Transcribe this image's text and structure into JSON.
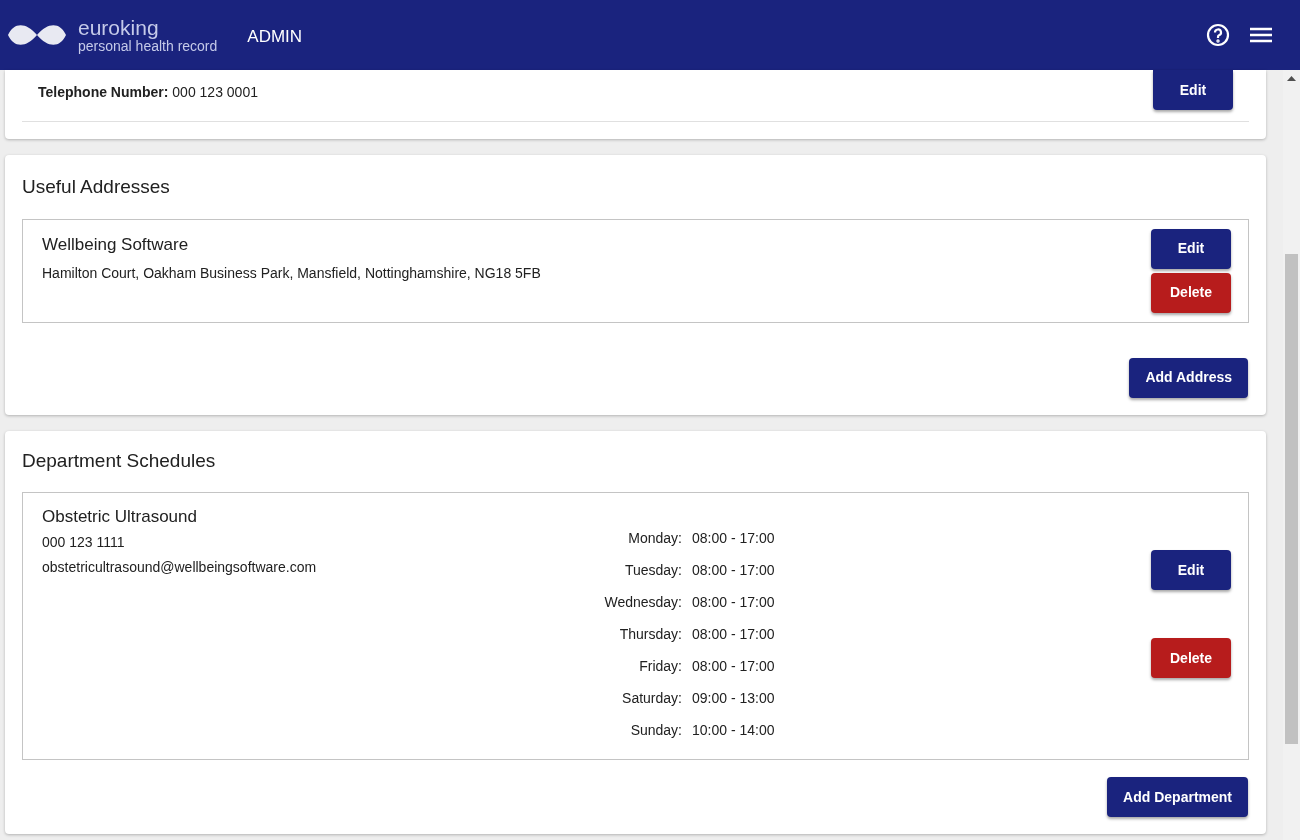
{
  "header": {
    "brand": "euroking",
    "tagline": "personal health record",
    "section": "ADMIN"
  },
  "contact_card": {
    "label": "Telephone Number:",
    "value": "000 123 0001",
    "edit_button": "Edit"
  },
  "useful_addresses": {
    "title": "Useful Addresses",
    "items": [
      {
        "name": "Wellbeing Software",
        "address": "Hamilton Court, Oakham Business Park, Mansfield, Nottinghamshire, NG18 5FB",
        "edit_button": "Edit",
        "delete_button": "Delete"
      }
    ],
    "add_button": "Add Address"
  },
  "department_schedules": {
    "title": "Department Schedules",
    "items": [
      {
        "name": "Obstetric Ultrasound",
        "phone": "000 123 1111",
        "email": "obstetricultrasound@wellbeingsoftware.com",
        "hours": [
          {
            "day": "Monday:",
            "time": "08:00 - 17:00"
          },
          {
            "day": "Tuesday:",
            "time": "08:00 - 17:00"
          },
          {
            "day": "Wednesday:",
            "time": "08:00 - 17:00"
          },
          {
            "day": "Thursday:",
            "time": "08:00 - 17:00"
          },
          {
            "day": "Friday:",
            "time": "08:00 - 17:00"
          },
          {
            "day": "Saturday:",
            "time": "09:00 - 13:00"
          },
          {
            "day": "Sunday:",
            "time": "10:00 - 14:00"
          }
        ],
        "edit_button": "Edit",
        "delete_button": "Delete"
      }
    ],
    "add_button": "Add Department"
  }
}
